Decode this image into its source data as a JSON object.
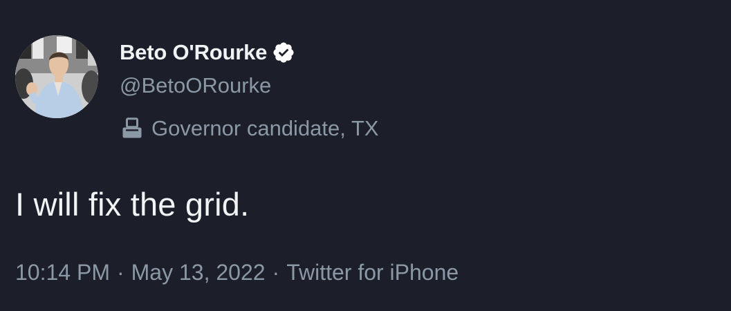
{
  "author": {
    "display_name": "Beto O'Rourke",
    "handle": "@BetoORourke",
    "verified_icon": "verified-badge-icon",
    "label_icon": "ballot-box-icon",
    "label_text": "Governor candidate, TX"
  },
  "tweet": {
    "text": "I will fix the grid."
  },
  "meta": {
    "time": "10:14 PM",
    "separator": "·",
    "date": "May 13, 2022",
    "source": "Twitter for iPhone"
  },
  "colors": {
    "background": "#1c1f2a",
    "primary_text": "#f1f3f5",
    "secondary_text": "#8b98a5",
    "badge": "#ffffff"
  }
}
